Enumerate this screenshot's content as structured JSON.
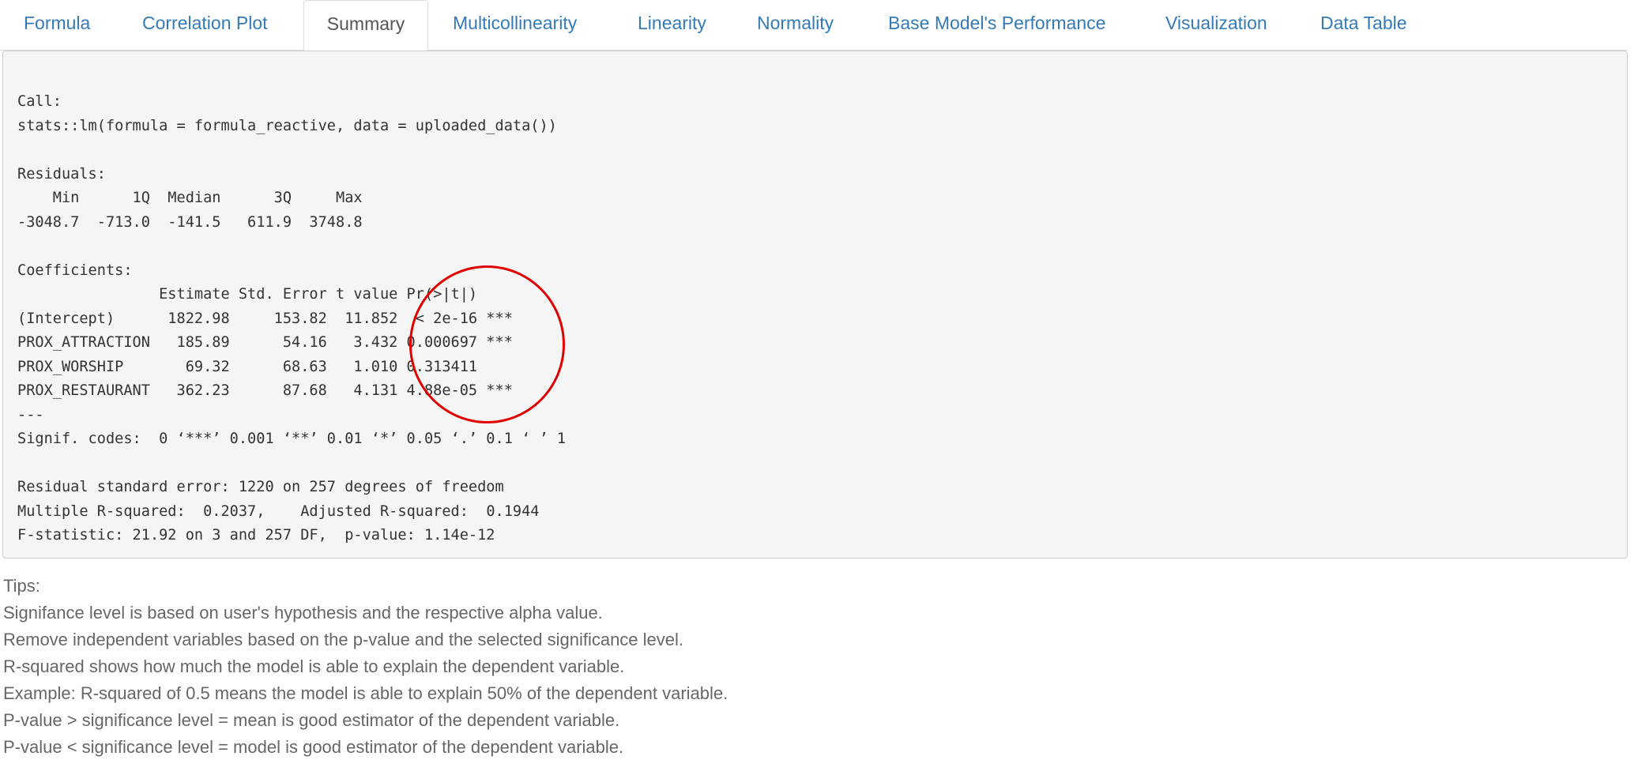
{
  "tabs": [
    {
      "label": "Formula",
      "active": false
    },
    {
      "label": "Correlation Plot",
      "active": false
    },
    {
      "label": "Summary",
      "active": true
    },
    {
      "label": "Multicollinearity",
      "active": false
    },
    {
      "label": "Linearity",
      "active": false
    },
    {
      "label": "Normality",
      "active": false
    },
    {
      "label": "Base Model's Performance",
      "active": false
    },
    {
      "label": "Visualization",
      "active": false
    },
    {
      "label": "Data Table",
      "active": false
    }
  ],
  "summary_output": "Call:\nstats::lm(formula = formula_reactive, data = uploaded_data())\n\nResiduals:\n    Min      1Q  Median      3Q     Max \n-3048.7  -713.0  -141.5   611.9  3748.8 \n\nCoefficients:\n                Estimate Std. Error t value Pr(>|t|)    \n(Intercept)      1822.98     153.82  11.852  < 2e-16 ***\nPROX_ATTRACTION   185.89      54.16   3.432 0.000697 ***\nPROX_WORSHIP       69.32      68.63   1.010 0.313411    \nPROX_RESTAURANT   362.23      87.68   4.131 4.88e-05 ***\n---\nSignif. codes:  0 ‘***’ 0.001 ‘**’ 0.01 ‘*’ 0.05 ‘.’ 0.1 ‘ ’ 1\n\nResidual standard error: 1220 on 257 degrees of freedom\nMultiple R-squared:  0.2037,\tAdjusted R-squared:  0.1944 \nF-statistic: 21.92 on 3 and 257 DF,  p-value: 1.14e-12",
  "annotation": {
    "color": "#e00000"
  },
  "tips": {
    "heading": "Tips:",
    "lines": [
      "Signifance level is based on user's hypothesis and the respective alpha value.",
      "Remove independent variables based on the p-value and the selected significance level.",
      "R-squared shows how much the model is able to explain the dependent variable.",
      "Example: R-squared of 0.5 means the model is able to explain 50% of the dependent variable.",
      "P-value > significance level = mean is good estimator of the dependent variable.",
      "P-value < significance level = model is good estimator of the dependent variable."
    ]
  },
  "colors": {
    "link": "#337ab7",
    "active_tab_text": "#555555",
    "panel_bg": "#f5f5f5",
    "tips_text": "#666666"
  }
}
